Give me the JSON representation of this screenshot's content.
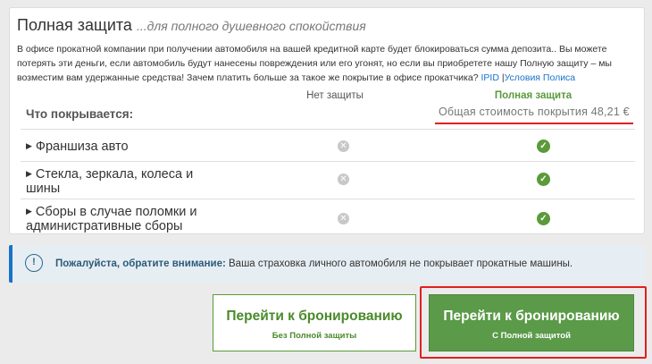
{
  "header": {
    "title": "Полная защита",
    "subtitle": "...для полного душевного спокойствия"
  },
  "description": {
    "text": "В офисе прокатной компании при получении автомобиля на вашей кредитной карте будет блокироваться сумма депозита.. Вы можете потерять эти деньги, если автомобиль будут нанесены повреждения или его угонят, но если вы приобретете нашу Полную защиту – мы возместим вам удержанные средства! Зачем платить больше за такое же покрытие в офисе прокатчика?",
    "link_ipid": "IPID",
    "separator": "|",
    "link_terms": "Условия Полиса"
  },
  "table": {
    "col_none": "Нет защиты",
    "col_full": "Полная защита",
    "total_cost": "Общая стоимость покрытия 48,21 €",
    "what_covers": "Что покрывается:",
    "rows": [
      {
        "label": "Франшиза авто"
      },
      {
        "label": "Стекла, зеркала, колеса и шины"
      },
      {
        "label": "Сборы в случае поломки и административные сборы"
      }
    ],
    "no_icon": "x-circle-icon",
    "yes_icon": "check-circle-icon"
  },
  "notice": {
    "icon": "info-icon",
    "bold": "Пожалуйста, обратите внимание:",
    "text": " Ваша страховка личного автомобиля не покрывает прокатные машины."
  },
  "buttons": {
    "without": {
      "label": "Перейти к бронированию",
      "sub": "Без Полной защиты"
    },
    "with": {
      "label": "Перейти к бронированию",
      "sub": "С Полной защитой"
    }
  },
  "colors": {
    "accent_green": "#5a9a48",
    "highlight_red": "#e02020",
    "link_blue": "#1a73c8"
  }
}
